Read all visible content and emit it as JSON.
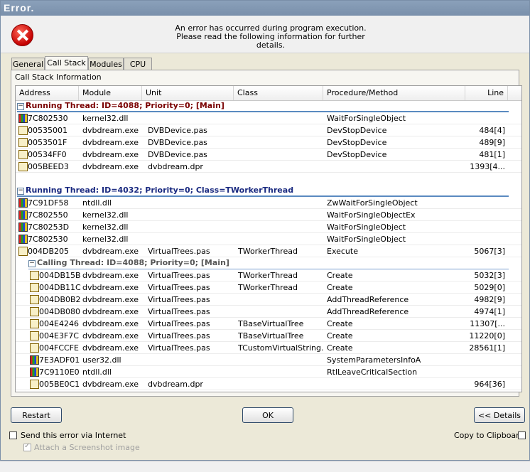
{
  "window": {
    "title": "Error."
  },
  "header": {
    "line1": "An error has occurred during program execution.",
    "line2": "Please read the following information for further details."
  },
  "tabs": [
    "General",
    "Call Stack",
    "Modules",
    "CPU"
  ],
  "active_tab": "Call Stack",
  "panel": {
    "label": "Call Stack Information"
  },
  "columns": [
    "Address",
    "Module",
    "Unit",
    "Class",
    "Procedure/Method",
    "Line"
  ],
  "groups": [
    {
      "title": "Running Thread: ID=4088; Priority=0; [Main]",
      "rows": [
        {
          "icon": "system-module-icon",
          "address": "7C802530",
          "module": "kernel32.dll",
          "unit": "",
          "class": "",
          "method": "WaitForSingleObject",
          "line": ""
        },
        {
          "icon": "app-module-icon",
          "address": "00535001",
          "module": "dvbdream.exe",
          "unit": "DVBDevice.pas",
          "class": "",
          "method": "DevStopDevice",
          "line": "484[4]"
        },
        {
          "icon": "app-module-icon",
          "address": "0053501F",
          "module": "dvbdream.exe",
          "unit": "DVBDevice.pas",
          "class": "",
          "method": "DevStopDevice",
          "line": "489[9]"
        },
        {
          "icon": "app-module-icon",
          "address": "00534FF0",
          "module": "dvbdream.exe",
          "unit": "DVBDevice.pas",
          "class": "",
          "method": "DevStopDevice",
          "line": "481[1]"
        },
        {
          "icon": "app-module-icon",
          "address": "005BEED3",
          "module": "dvbdream.exe",
          "unit": "dvbdream.dpr",
          "class": "",
          "method": "",
          "line": "1393[4..."
        }
      ]
    },
    {
      "title": "Running Thread: ID=4032; Priority=0; Class=TWorkerThread",
      "rows": [
        {
          "icon": "system-module-icon",
          "address": "7C91DF58",
          "module": "ntdll.dll",
          "unit": "",
          "class": "",
          "method": "ZwWaitForSingleObject",
          "line": ""
        },
        {
          "icon": "system-module-icon",
          "address": "7C802550",
          "module": "kernel32.dll",
          "unit": "",
          "class": "",
          "method": "WaitForSingleObjectEx",
          "line": ""
        },
        {
          "icon": "system-module-icon",
          "address": "7C80253D",
          "module": "kernel32.dll",
          "unit": "",
          "class": "",
          "method": "WaitForSingleObject",
          "line": ""
        },
        {
          "icon": "system-module-icon",
          "address": "7C802530",
          "module": "kernel32.dll",
          "unit": "",
          "class": "",
          "method": "WaitForSingleObject",
          "line": ""
        },
        {
          "icon": "app-module-icon",
          "address": "004DB205",
          "module": "dvbdream.exe",
          "unit": "VirtualTrees.pas",
          "class": "TWorkerThread",
          "method": "Execute",
          "line": "5067[3]"
        }
      ]
    }
  ],
  "calling": {
    "title": "Calling Thread: ID=4088; Priority=0; [Main]",
    "rows": [
      {
        "icon": "app-module-icon",
        "address": "004DB15B",
        "module": "dvbdream.exe",
        "unit": "VirtualTrees.pas",
        "class": "TWorkerThread",
        "method": "Create",
        "line": "5032[3]"
      },
      {
        "icon": "app-module-icon",
        "address": "004DB11C",
        "module": "dvbdream.exe",
        "unit": "VirtualTrees.pas",
        "class": "TWorkerThread",
        "method": "Create",
        "line": "5029[0]"
      },
      {
        "icon": "app-module-icon",
        "address": "004DB0B2",
        "module": "dvbdream.exe",
        "unit": "VirtualTrees.pas",
        "class": "",
        "method": "AddThreadReference",
        "line": "4982[9]"
      },
      {
        "icon": "app-module-icon",
        "address": "004DB080",
        "module": "dvbdream.exe",
        "unit": "VirtualTrees.pas",
        "class": "",
        "method": "AddThreadReference",
        "line": "4974[1]"
      },
      {
        "icon": "app-module-icon",
        "address": "004E4246",
        "module": "dvbdream.exe",
        "unit": "VirtualTrees.pas",
        "class": "TBaseVirtualTree",
        "method": "Create",
        "line": "11307[..."
      },
      {
        "icon": "app-module-icon",
        "address": "004E3F7C",
        "module": "dvbdream.exe",
        "unit": "VirtualTrees.pas",
        "class": "TBaseVirtualTree",
        "method": "Create",
        "line": "11220[0]"
      },
      {
        "icon": "app-module-icon",
        "address": "004FCCFE",
        "module": "dvbdream.exe",
        "unit": "VirtualTrees.pas",
        "class": "TCustomVirtualString...",
        "method": "Create",
        "line": "28561[1]"
      },
      {
        "icon": "system-module-icon",
        "address": "7E3ADF01",
        "module": "user32.dll",
        "unit": "",
        "class": "",
        "method": "SystemParametersInfoA",
        "line": ""
      },
      {
        "icon": "system-module-icon",
        "address": "7C9110E0",
        "module": "ntdll.dll",
        "unit": "",
        "class": "",
        "method": "RtlLeaveCriticalSection",
        "line": ""
      },
      {
        "icon": "app-module-icon",
        "address": "005BE0C1",
        "module": "dvbdream.exe",
        "unit": "dvbdream.dpr",
        "class": "",
        "method": "",
        "line": "964[36]"
      }
    ]
  },
  "buttons": {
    "restart": "Restart",
    "ok": "OK",
    "details": "<< Details"
  },
  "options": {
    "send_internet": {
      "label": "Send this error via Internet",
      "checked": false
    },
    "attach_screenshot": {
      "label": "Attach a Screenshot image",
      "checked": true,
      "disabled": true
    },
    "copy_clipboard": {
      "label": "Copy to Clipboard",
      "checked": false
    }
  }
}
